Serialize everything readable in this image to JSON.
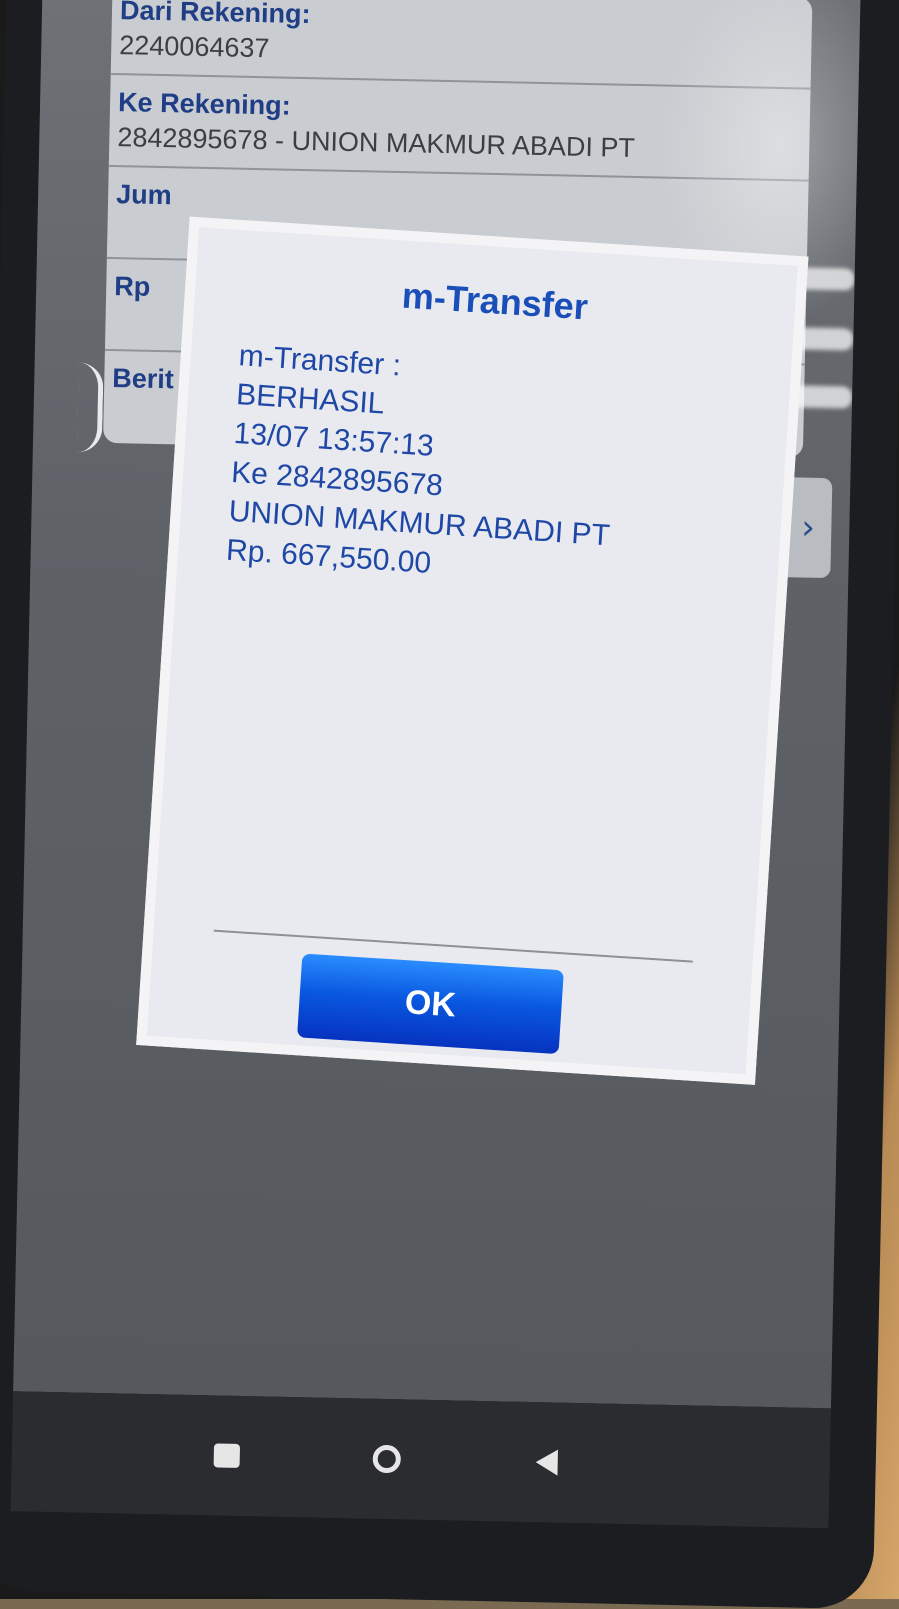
{
  "form": {
    "rows": [
      {
        "label": "Dari Rekening:",
        "value": "2240064637"
      },
      {
        "label": "Ke Rekening:",
        "value": "2842895678 - UNION MAKMUR ABADI PT"
      },
      {
        "label": "Jum",
        "value": ""
      },
      {
        "label": "Rp",
        "value": ""
      },
      {
        "label": "Berit",
        "value": ""
      }
    ]
  },
  "dialog": {
    "title": "m-Transfer",
    "lines": [
      "m-Transfer :",
      "BERHASIL",
      "13/07 13:57:13",
      "Ke 2842895678",
      "UNION MAKMUR ABADI PT",
      "Rp. 667,550.00"
    ],
    "ok_label": "OK"
  },
  "navbar": {
    "icons": [
      "recents-icon",
      "home-icon",
      "back-icon"
    ]
  },
  "colors": {
    "dialog_text": "#1f48a6",
    "form_label": "#1f3e86",
    "ok_button": "#0a58e0"
  }
}
